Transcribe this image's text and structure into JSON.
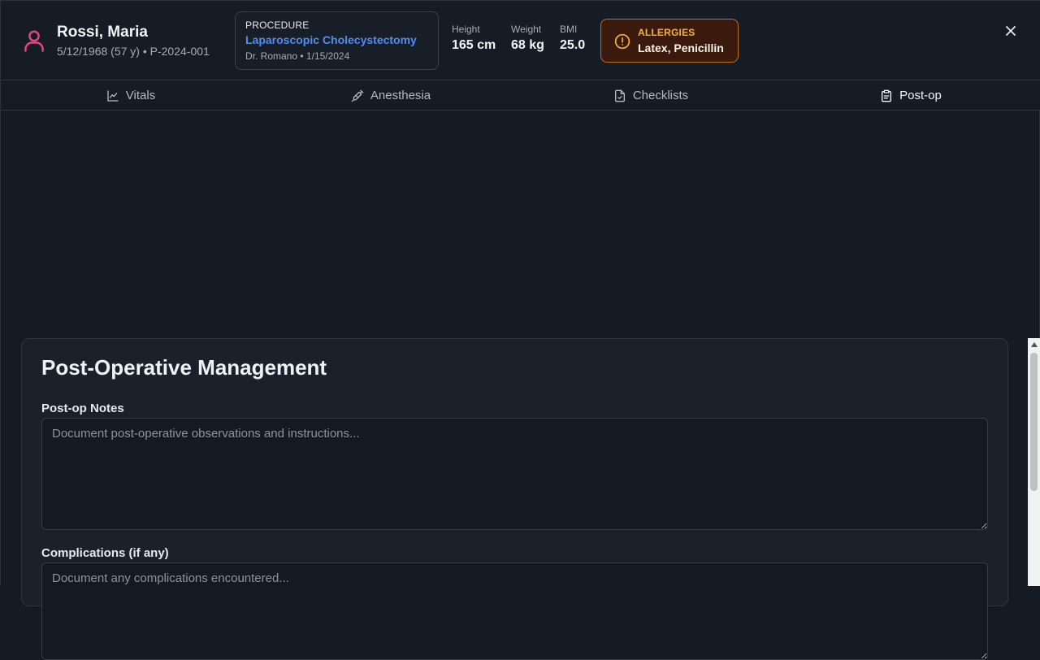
{
  "patient": {
    "name": "Rossi, Maria",
    "meta": "5/12/1968 (57 y) • P-2024-001"
  },
  "procedure": {
    "label": "PROCEDURE",
    "name": "Laparoscopic Cholecystectomy",
    "meta": "Dr. Romano • 1/15/2024"
  },
  "metrics": {
    "height_label": "Height",
    "height_value": "165 cm",
    "weight_label": "Weight",
    "weight_value": "68 kg",
    "bmi_label": "BMI",
    "bmi_value": "25.0"
  },
  "allergies": {
    "label": "ALLERGIES",
    "value": "Latex, Penicillin"
  },
  "tabs": [
    {
      "label": "Vitals",
      "icon": "line-chart-icon"
    },
    {
      "label": "Anesthesia",
      "icon": "syringe-icon"
    },
    {
      "label": "Checklists",
      "icon": "file-check-icon"
    },
    {
      "label": "Post-op",
      "icon": "clipboard-icon",
      "active": true
    }
  ],
  "postop": {
    "title": "Post-Operative Management",
    "notes_label": "Post-op Notes",
    "notes_placeholder": "Document post-operative observations and instructions...",
    "notes_value": "",
    "complications_label": "Complications (if any)",
    "complications_placeholder": "Document any complications encountered...",
    "complications_value": ""
  },
  "colors": {
    "accent": "#4f8ef2",
    "patient_icon": "#e2457e",
    "allergy_bg": "#3a1a0d",
    "allergy_border": "#c46a22",
    "allergy_label": "#f5b13d"
  }
}
